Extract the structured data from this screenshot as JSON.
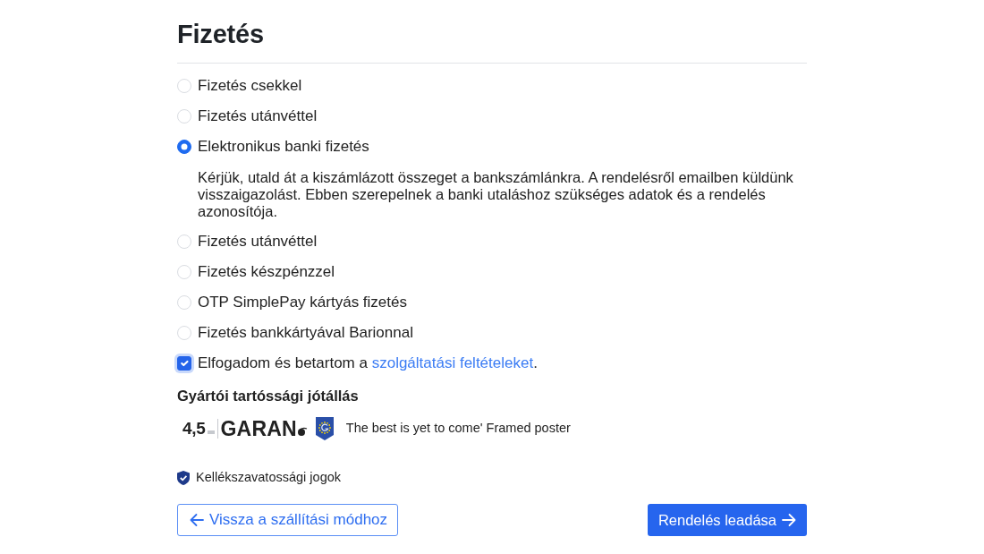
{
  "title": "Fizetés",
  "payment_methods": [
    {
      "label": "Fizetés csekkel",
      "selected": false
    },
    {
      "label": "Fizetés utánvéttel",
      "selected": false
    },
    {
      "label": "Elektronikus banki fizetés",
      "selected": true,
      "description": "Kérjük, utald át a kiszámlázott összeget a bankszámlánkra. A rendelésről emailben küldünk visszaigazolást. Ebben szerepelnek a banki utaláshoz szükséges adatok és a rendelés azonosítója."
    },
    {
      "label": "Fizetés utánvéttel",
      "selected": false
    },
    {
      "label": "Fizetés készpénzzel",
      "selected": false
    },
    {
      "label": "OTP SimplePay kártyás fizetés",
      "selected": false
    },
    {
      "label": "Fizetés bankkártyával Barionnal",
      "selected": false
    }
  ],
  "terms": {
    "checked": true,
    "text_before": "Elfogadom és betartom a ",
    "link": "szolgáltatási feltételeket",
    "text_after": "."
  },
  "warranty": {
    "heading": "Gyártói tartóssági jótállás",
    "logo_number": "4,5",
    "logo_word": "GARAN",
    "product": "The best is yet to come' Framed poster"
  },
  "rights_link": "Kellékszavatossági jogok",
  "buttons": {
    "back": "Vissza a szállítási módhoz",
    "submit": "Rendelés leadása"
  }
}
